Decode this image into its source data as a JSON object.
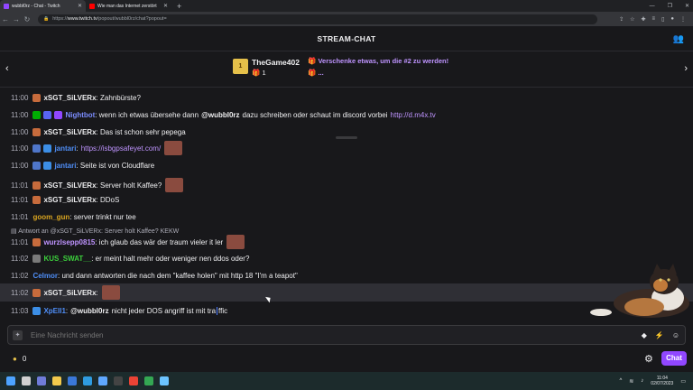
{
  "browser": {
    "tabs": [
      {
        "title": "wubbl0rz - Chat - Twitch",
        "favicon_color": "#9147ff"
      },
      {
        "title": "Wie man das Internet zerstört",
        "favicon_color": "#ff0000"
      }
    ],
    "url_prefix": "https://",
    "url_host": "www.twitch.tv",
    "url_path": "/popout/wubbl0rz/chat?popout="
  },
  "header": {
    "title": "STREAM-CHAT"
  },
  "banner": {
    "username": "TheGame402",
    "gift_count": "1",
    "cta": "Verschenke etwas, um die #2 zu werden!",
    "more": "..."
  },
  "messages": [
    {
      "time": "11:00",
      "badges": [
        "#c76b3c"
      ],
      "user": "xSGT_SiLVERx",
      "color": "#efeff1",
      "text": ": Zahnbürste?"
    },
    {
      "time": "11:00",
      "badges": [
        "#00ad03",
        "#5865f2",
        "#9147ff"
      ],
      "user": "Nightbot",
      "color": "#7c8dff",
      "text": ": wenn ich etwas übersehe dann",
      "mention": "@wubbl0rz",
      "text2": "dazu schreiben oder schaut im discord vorbei",
      "link": "http://d.m4x.tv"
    },
    {
      "time": "11:00",
      "badges": [
        "#c76b3c"
      ],
      "user": "xSGT_SiLVERx",
      "color": "#efeff1",
      "text": ": Das ist schon sehr pepega"
    },
    {
      "time": "11:00",
      "badges": [
        "#4f76c9",
        "#3c8ee6"
      ],
      "user": "jantari",
      "color": "#4f8ef7",
      "text": ":",
      "link": "https://isbgpsafeyet.com/",
      "emote": true
    },
    {
      "time": "11:00",
      "badges": [
        "#4f76c9",
        "#3c8ee6"
      ],
      "user": "jantari",
      "color": "#4f8ef7",
      "text": ": Seite ist von Cloudflare"
    },
    {
      "time": "11:01",
      "badges": [
        "#c76b3c"
      ],
      "user": "xSGT_SiLVERx",
      "color": "#efeff1",
      "text": ": Server holt Kaffee?",
      "emote": true
    },
    {
      "time": "11:01",
      "badges": [
        "#c76b3c"
      ],
      "user": "xSGT_SiLVERx",
      "color": "#efeff1",
      "text": ": DDoS"
    },
    {
      "time": "11:01",
      "badges": [],
      "user": "goom_gun",
      "color": "#daa520",
      "text": ": server trinkt nur tee"
    },
    {
      "time": "11:01",
      "badges": [
        "#c76b3c"
      ],
      "user": "wurzlsepp0815",
      "color": "#bf94ff",
      "text": ": ich glaub das wär der traum vieler it ler",
      "emote": true,
      "reply": "Antwort an @xSGT_SiLVERx: Server holt Kaffee? KEKW"
    },
    {
      "time": "11:02",
      "badges": [
        "#7a7a7a"
      ],
      "user": "KUS_SWAT__",
      "color": "#3ccf3c",
      "text": ": er meint halt mehr oder weniger nen ddos oder?"
    },
    {
      "time": "11:02",
      "badges": [],
      "user": "Celmor",
      "color": "#4f8ef7",
      "text": ": und dann antworten die nach dem \"kaffee holen\" mit http 18 \"I'm a teapot\""
    },
    {
      "time": "11:02",
      "badges": [
        "#c76b3c"
      ],
      "user": "xSGT_SiLVERx",
      "color": "#efeff1",
      "text": ":",
      "emote": true,
      "highlight": true
    },
    {
      "time": "11:03",
      "badges": [
        "#3c8ee6"
      ],
      "user": "XpEll1",
      "color": "#4f8ef7",
      "text": ":",
      "mention": "@wubbl0rz",
      "text2": "nicht jeder DOS angriff ist mit tra",
      "text3": "ffic"
    }
  ],
  "input": {
    "placeholder": "Eine Nachricht senden"
  },
  "footer": {
    "points": "0",
    "chat_button": "Chat"
  },
  "taskbar": {
    "time": "11:04",
    "date": "02/07/2023"
  },
  "colors": {
    "accent": "#9147ff",
    "link": "#bf94ff",
    "background": "#18181b"
  }
}
